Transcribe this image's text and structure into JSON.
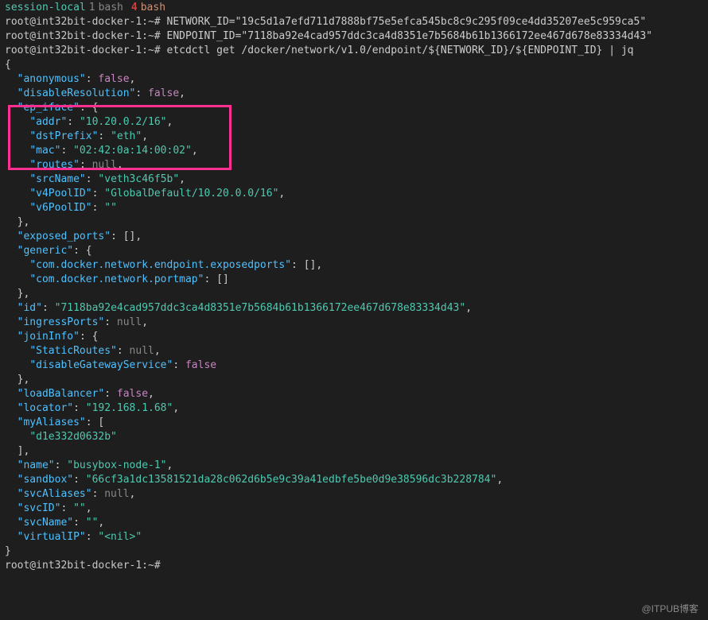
{
  "tabs": {
    "session": "session-local",
    "items": [
      {
        "index": "1",
        "label": "bash",
        "active": false
      },
      {
        "index": "4",
        "label": "bash",
        "active": true
      }
    ]
  },
  "prompt": "root@int32bit-docker-1:~#",
  "commands": {
    "c1": "NETWORK_ID=\"19c5d1a7efd711d7888bf75e5efca545bc8c9c295f09ce4dd35207ee5c959ca5\"",
    "c2": "ENDPOINT_ID=\"7118ba92e4cad957ddc3ca4d8351e7b5684b61b1366172ee467d678e83334d43\"",
    "c3": "etcdctl get /docker/network/v1.0/endpoint/${NETWORK_ID}/${ENDPOINT_ID} | jq"
  },
  "json": {
    "anonymous_key": "\"anonymous\"",
    "anonymous_val": "false",
    "disableResolution_key": "\"disableResolution\"",
    "disableResolution_val": "false",
    "ep_iface_key": "\"ep_iface\"",
    "ep_iface": {
      "addr_key": "\"addr\"",
      "addr_val": "\"10.20.0.2/16\"",
      "dstPrefix_key": "\"dstPrefix\"",
      "dstPrefix_val": "\"eth\"",
      "mac_key": "\"mac\"",
      "mac_val": "\"02:42:0a:14:00:02\"",
      "routes_key": "\"routes\"",
      "routes_val": "null",
      "srcName_key": "\"srcName\"",
      "srcName_val": "\"veth3c46f5b\"",
      "v4PoolID_key": "\"v4PoolID\"",
      "v4PoolID_val": "\"GlobalDefault/10.20.0.0/16\"",
      "v6PoolID_key": "\"v6PoolID\"",
      "v6PoolID_val": "\"\""
    },
    "exposed_ports_key": "\"exposed_ports\"",
    "generic_key": "\"generic\"",
    "generic": {
      "exposedports_key": "\"com.docker.network.endpoint.exposedports\"",
      "portmap_key": "\"com.docker.network.portmap\""
    },
    "id_key": "\"id\"",
    "id_val": "\"7118ba92e4cad957ddc3ca4d8351e7b5684b61b1366172ee467d678e83334d43\"",
    "ingressPorts_key": "\"ingressPorts\"",
    "ingressPorts_val": "null",
    "joinInfo_key": "\"joinInfo\"",
    "joinInfo": {
      "StaticRoutes_key": "\"StaticRoutes\"",
      "StaticRoutes_val": "null",
      "disableGatewayService_key": "\"disableGatewayService\"",
      "disableGatewayService_val": "false"
    },
    "loadBalancer_key": "\"loadBalancer\"",
    "loadBalancer_val": "false",
    "locator_key": "\"locator\"",
    "locator_val": "\"192.168.1.68\"",
    "myAliases_key": "\"myAliases\"",
    "myAliases_item": "\"d1e332d0632b\"",
    "name_key": "\"name\"",
    "name_val": "\"busybox-node-1\"",
    "sandbox_key": "\"sandbox\"",
    "sandbox_val": "\"66cf3a1dc13581521da28c062d6b5e9c39a41edbfe5be0d9e38596dc3b228784\"",
    "svcAliases_key": "\"svcAliases\"",
    "svcAliases_val": "null",
    "svcID_key": "\"svcID\"",
    "svcID_val": "\"\"",
    "svcName_key": "\"svcName\"",
    "svcName_val": "\"\"",
    "virtualIP_key": "\"virtualIP\"",
    "virtualIP_val": "\"<nil>\""
  },
  "watermark": "@ITPUB博客"
}
